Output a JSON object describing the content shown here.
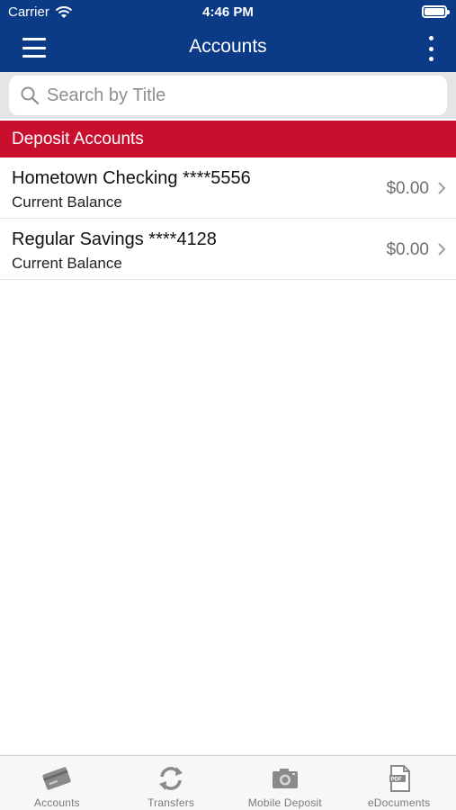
{
  "status_bar": {
    "carrier": "Carrier",
    "time": "4:46 PM"
  },
  "nav": {
    "title": "Accounts"
  },
  "search": {
    "placeholder": "Search by Title",
    "value": ""
  },
  "section": {
    "title": "Deposit Accounts"
  },
  "accounts": [
    {
      "name": "Hometown Checking ****5556",
      "subtitle": "Current Balance",
      "balance": "$0.00"
    },
    {
      "name": "Regular Savings ****4128",
      "subtitle": "Current Balance",
      "balance": "$0.00"
    }
  ],
  "tabs": [
    {
      "label": "Accounts",
      "icon": "card-icon"
    },
    {
      "label": "Transfers",
      "icon": "transfer-icon"
    },
    {
      "label": "Mobile Deposit",
      "icon": "camera-icon"
    },
    {
      "label": "eDocuments",
      "icon": "pdf-icon"
    }
  ],
  "colors": {
    "header_blue": "#0b3a86",
    "section_red": "#c8102e",
    "tab_icon_gray": "#8a8a8a"
  }
}
